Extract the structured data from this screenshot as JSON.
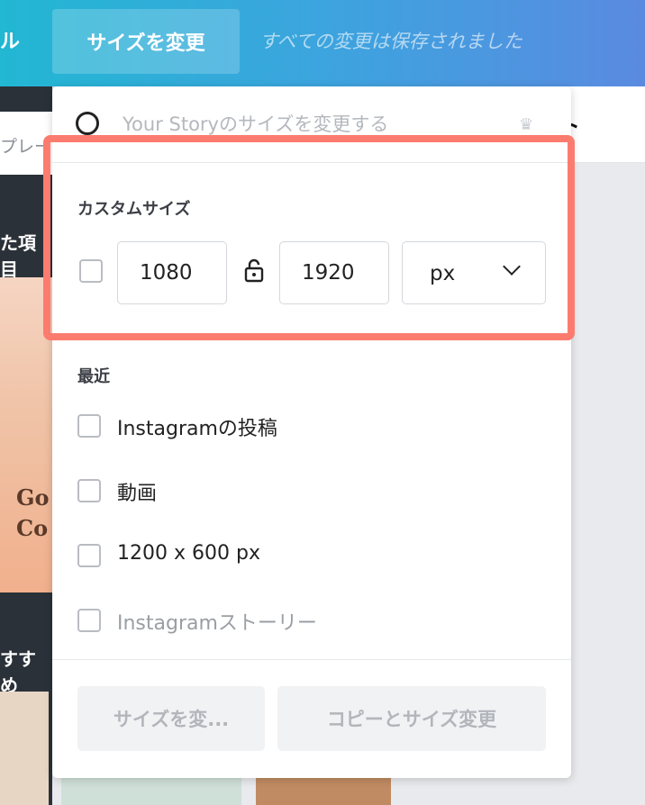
{
  "topbar": {
    "partial_left": "ル",
    "resize_button": "サイズを変更",
    "saved_status": "すべての変更は保存されました"
  },
  "background": {
    "left_search_partial": "プレー",
    "left_heading_partial": "た項目",
    "left_thumb_text_1": "Go",
    "left_thumb_text_2": "Co",
    "left_heading2_partial": "すすめ",
    "right_header_partial": "ト"
  },
  "panel": {
    "search": {
      "placeholder": "Your Storyのサイズを変更する",
      "value": ""
    },
    "custom_size": {
      "label": "カスタムサイズ",
      "width": "1080",
      "height": "1920",
      "unit": "px",
      "checked": false
    },
    "recent": {
      "label": "最近",
      "items": [
        {
          "label": "Instagramの投稿",
          "checked": false,
          "dimmed": false
        },
        {
          "label": "動画",
          "checked": false,
          "dimmed": false
        },
        {
          "label": "1200 x 600 px",
          "checked": false,
          "dimmed": false
        },
        {
          "label": "Instagramストーリー",
          "checked": false,
          "dimmed": true
        }
      ]
    },
    "footer": {
      "resize_label": "サイズを変...",
      "copy_resize_label": "コピーとサイズ変更"
    }
  },
  "colors": {
    "highlight": "#fb7c6f",
    "topbar_start": "#22b7d3",
    "topbar_end": "#5a8ae0"
  }
}
